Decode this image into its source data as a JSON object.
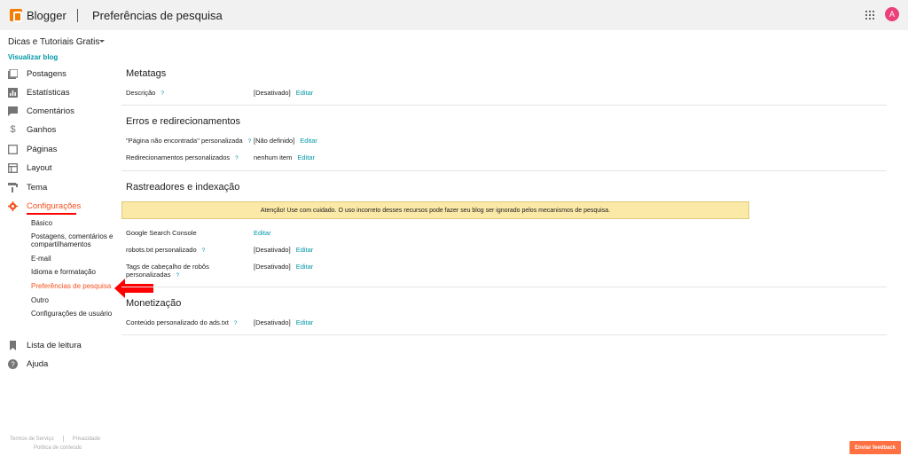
{
  "header": {
    "brand": "Blogger",
    "page_title": "Preferências de pesquisa",
    "avatar_letter": "A",
    "apps_icon": "apps-grid-icon"
  },
  "sidebar": {
    "blog_name": "Dicas e Tutoriais Gratis",
    "view_blog": "Visualizar blog",
    "items": [
      {
        "label": "Postagens",
        "icon": "posts-icon"
      },
      {
        "label": "Estatísticas",
        "icon": "stats-icon"
      },
      {
        "label": "Comentários",
        "icon": "comments-icon"
      },
      {
        "label": "Ganhos",
        "icon": "dollar-icon"
      },
      {
        "label": "Páginas",
        "icon": "pages-icon"
      },
      {
        "label": "Layout",
        "icon": "layout-icon"
      },
      {
        "label": "Tema",
        "icon": "paint-roller-icon"
      },
      {
        "label": "Configurações",
        "icon": "gear-icon",
        "active": true
      }
    ],
    "sub_items": [
      {
        "label": "Básico"
      },
      {
        "label": "Postagens, comentários e compartilhamentos"
      },
      {
        "label": "E-mail"
      },
      {
        "label": "Idioma e formatação"
      },
      {
        "label": "Preferências de pesquisa",
        "active": true
      },
      {
        "label": "Outro"
      },
      {
        "label": "Configurações de usuário"
      }
    ],
    "bottom_items": [
      {
        "label": "Lista de leitura",
        "icon": "bookmark-icon"
      },
      {
        "label": "Ajuda",
        "icon": "help-icon"
      }
    ]
  },
  "footer": {
    "terms": "Termos de Serviço",
    "privacy": "Privacidade",
    "content_policy": "Política de conteúdo",
    "feedback": "Enviar feedback"
  },
  "main": {
    "metatags": {
      "title": "Metatags",
      "description_label": "Descrição",
      "description_value": "[Desativado]",
      "edit": "Editar"
    },
    "errors": {
      "title": "Erros e redirecionamentos",
      "not_found_label": "\"Página não encontrada\" personalizada",
      "not_found_value": "[Não definido]",
      "redirects_label": "Redirecionamentos personalizados",
      "redirects_value": "nenhum item",
      "edit": "Editar"
    },
    "crawlers": {
      "title": "Rastreadores e indexação",
      "warning": "Atenção! Use com cuidado. O uso incorreto desses recursos pode fazer seu blog ser ignorado pelos mecanismos de pesquisa.",
      "gsc_label": "Google Search Console",
      "robots_label": "robots.txt personalizado",
      "robots_value": "[Desativado]",
      "tags_label_1": "Tags de cabeçalho de robôs",
      "tags_label_2": "personalizadas",
      "tags_value": "[Desativado]",
      "edit": "Editar"
    },
    "monetization": {
      "title": "Monetização",
      "ads_label": "Conteúdo personalizado do ads.txt",
      "ads_value": "[Desativado]",
      "edit": "Editar"
    },
    "help_mark": "?"
  },
  "colors": {
    "accent": "#f4511e",
    "link": "#0097a7",
    "warning_bg": "#fbe9a7",
    "arrow": "#ff0000"
  }
}
